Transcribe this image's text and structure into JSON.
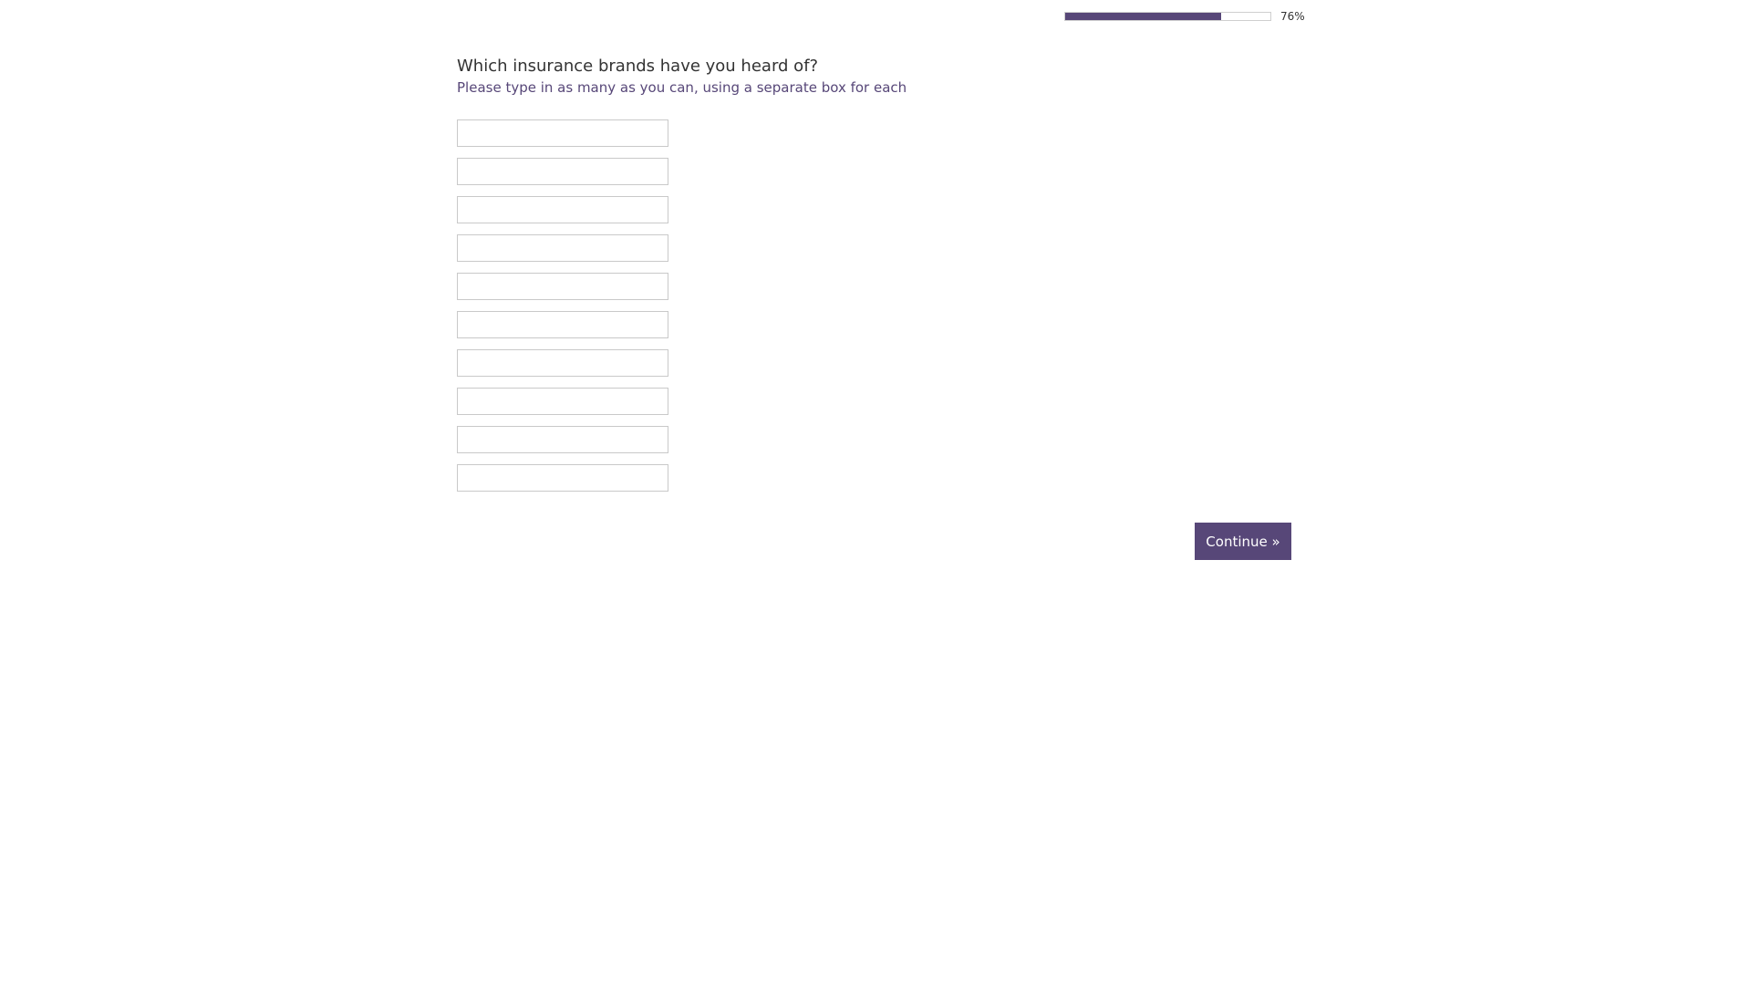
{
  "progress": {
    "value": 0.76,
    "label": "76%"
  },
  "question": {
    "title": "Which insurance brands have you heard of?",
    "subtitle": "Please type in as many as you can, using a separate box for each"
  },
  "answers": [
    {
      "value": "",
      "placeholder": ""
    },
    {
      "value": "",
      "placeholder": ""
    },
    {
      "value": "",
      "placeholder": ""
    },
    {
      "value": "",
      "placeholder": ""
    },
    {
      "value": "",
      "placeholder": ""
    },
    {
      "value": "",
      "placeholder": ""
    },
    {
      "value": "",
      "placeholder": ""
    },
    {
      "value": "",
      "placeholder": ""
    },
    {
      "value": "",
      "placeholder": ""
    },
    {
      "value": "",
      "placeholder": ""
    }
  ],
  "continue_label": "Continue »",
  "colors": {
    "accent": "#574778",
    "text": "#333333",
    "border": "#c9c9c9"
  }
}
